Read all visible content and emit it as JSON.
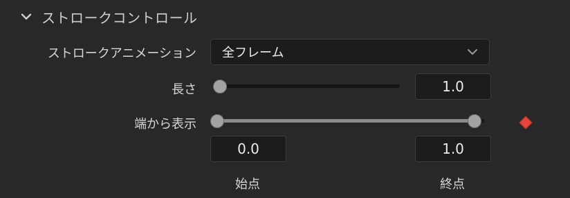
{
  "section": {
    "title": "ストロークコントロール",
    "chevron_icon": "chevron-down-icon"
  },
  "stroke_animation": {
    "label": "ストロークアニメーション",
    "value": "全フレーム",
    "chevron_icon": "chevron-down-icon"
  },
  "length": {
    "label": "長さ",
    "value": "1.0",
    "slider_fraction": 0.0
  },
  "show_from_edges": {
    "label": "端から表示",
    "start_fraction": 0.0,
    "end_fraction": 1.0,
    "keyframe_icon": "keyframe-diamond-icon",
    "keyframe_color": "#e5443b",
    "start": {
      "value": "0.0",
      "caption": "始点"
    },
    "end": {
      "value": "1.0",
      "caption": "終点"
    }
  },
  "colors": {
    "background": "#28282a",
    "field": "#1c1c1e",
    "track_filled": "#8c8c8c",
    "track_empty": "#161616"
  }
}
